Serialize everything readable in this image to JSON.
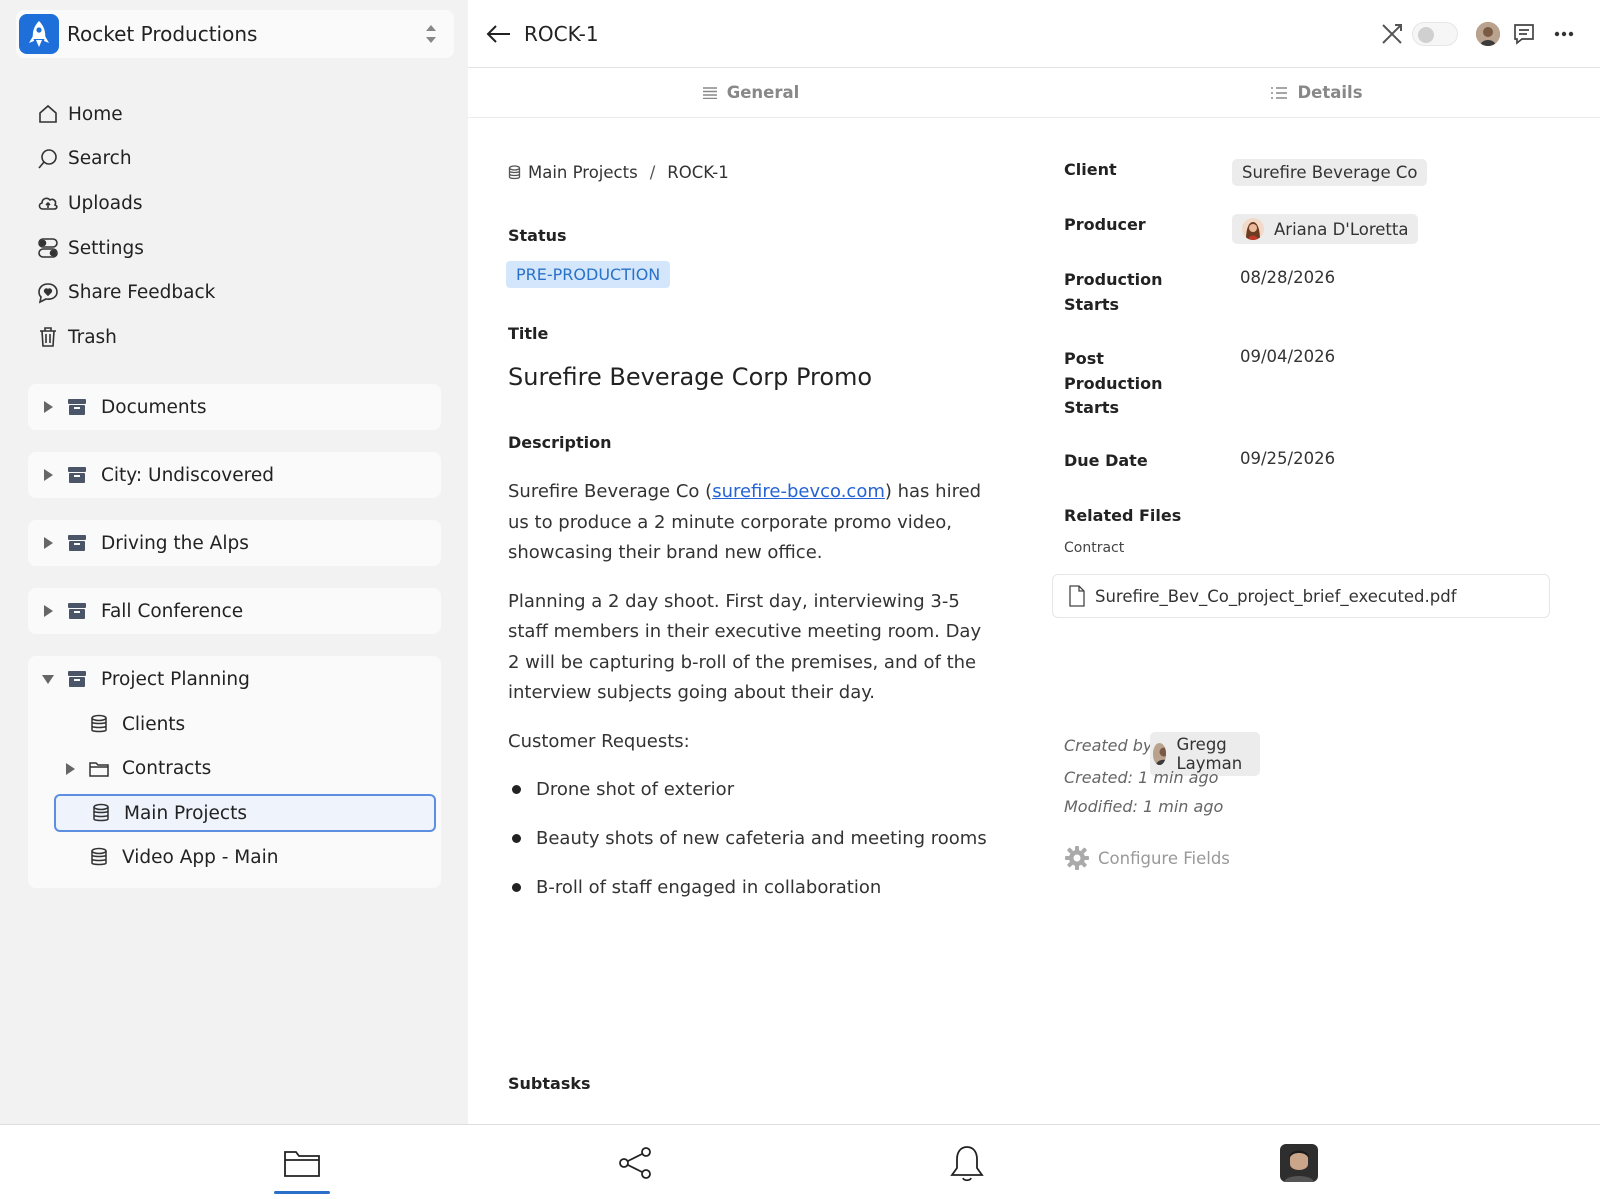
{
  "workspace": {
    "name": "Rocket Productions",
    "icon": "rocket-icon"
  },
  "nav": [
    {
      "label": "Home",
      "icon": "home-icon"
    },
    {
      "label": "Search",
      "icon": "search-icon"
    },
    {
      "label": "Uploads",
      "icon": "cloud-upload-icon"
    },
    {
      "label": "Settings",
      "icon": "toggles-icon"
    },
    {
      "label": "Share Feedback",
      "icon": "chat-heart-icon"
    },
    {
      "label": "Trash",
      "icon": "trash-icon"
    }
  ],
  "groups": [
    {
      "label": "Documents",
      "expanded": false
    },
    {
      "label": "City: Undiscovered",
      "expanded": false
    },
    {
      "label": "Driving the Alps",
      "expanded": false
    },
    {
      "label": "Fall Conference",
      "expanded": false
    },
    {
      "label": "Project Planning",
      "expanded": true,
      "children": [
        {
          "label": "Clients",
          "icon": "database-icon"
        },
        {
          "label": "Contracts",
          "icon": "folder-icon"
        },
        {
          "label": "Main Projects",
          "icon": "database-icon",
          "selected": true
        },
        {
          "label": "Video App - Main",
          "icon": "database-icon"
        }
      ]
    }
  ],
  "header": {
    "page_id": "ROCK-1"
  },
  "tabs": [
    {
      "label": "General"
    },
    {
      "label": "Details"
    }
  ],
  "breadcrumb": {
    "parent": "Main Projects",
    "separator": "/",
    "current": "ROCK-1"
  },
  "status": {
    "label": "Status",
    "value": "PRE-PRODUCTION"
  },
  "title": {
    "label": "Title",
    "value": "Surefire Beverage Corp Promo"
  },
  "description": {
    "label": "Description",
    "p1_before": "Surefire Beverage Co (",
    "p1_link": "surefire-bevco.com",
    "p1_after": ") has hired us to produce a 2 minute corporate promo video, showcasing their brand new office.",
    "p2": "Planning a 2 day shoot. First day, interviewing 3-5 staff members in their executive meeting room. Day 2 will be capturing b-roll of the premises, and of the interview subjects going about their day.",
    "p3": "Customer Requests:",
    "bullets": [
      "Drone shot of exterior",
      "Beauty shots of new cafeteria and meeting rooms",
      "B-roll of staff engaged in collaboration"
    ]
  },
  "details": {
    "client": {
      "label": "Client",
      "value": "Surefire Beverage Co"
    },
    "producer": {
      "label": "Producer",
      "value": "Ariana D'Loretta"
    },
    "production_starts": {
      "label": "Production Starts",
      "value": "08/28/2026"
    },
    "post_production_starts": {
      "label": "Post Production Starts",
      "value": "09/04/2026"
    },
    "due_date": {
      "label": "Due Date",
      "value": "09/25/2026"
    },
    "related_files": {
      "label": "Related Files",
      "sublabel": "Contract",
      "file": "Surefire_Bev_Co_project_brief_executed.pdf"
    }
  },
  "meta": {
    "created_by_label": "Created by:",
    "created_by": "Gregg Layman",
    "created": "Created: 1 min ago",
    "modified": "Modified: 1 min ago",
    "configure": "Configure Fields"
  },
  "subtasks": {
    "label": "Subtasks"
  },
  "colors": {
    "accent": "#2a6fc9",
    "badge_bg": "#d3e6fb",
    "badge_text": "#2a72c8",
    "sidebar_bg": "#f2f2f2"
  }
}
